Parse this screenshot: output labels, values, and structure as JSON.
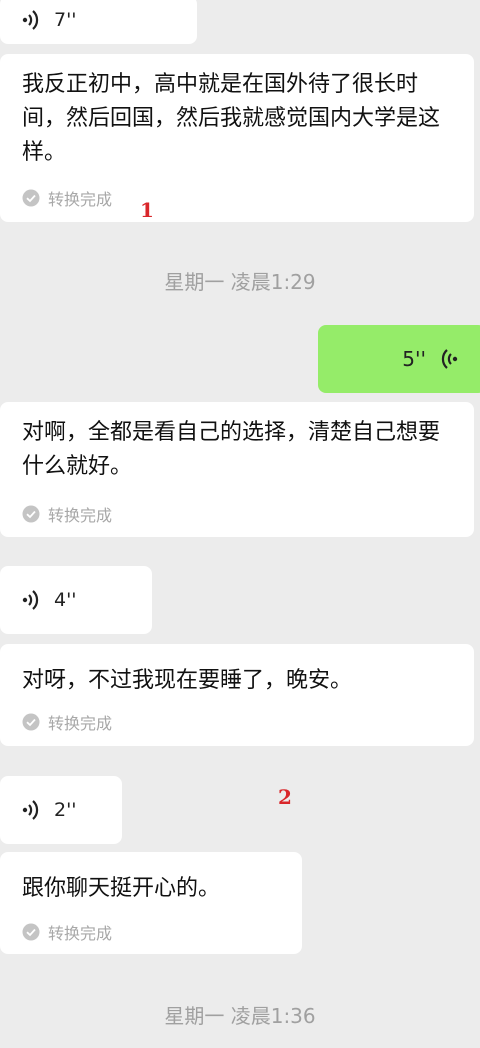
{
  "colors": {
    "background": "#ececec",
    "bubble_in": "#ffffff",
    "bubble_out": "#95ec69",
    "annotation": "#d9262a"
  },
  "messages": [
    {
      "kind": "voice",
      "direction": "in",
      "duration": "7''"
    },
    {
      "kind": "text",
      "direction": "in",
      "text": "我反正初中，高中就是在国外待了很长时间，然后回国，然后我就感觉国内大学是这样。",
      "status": "转换完成"
    },
    {
      "kind": "timestamp",
      "text": "星期一 凌晨1:29"
    },
    {
      "kind": "voice",
      "direction": "out",
      "duration": "5''"
    },
    {
      "kind": "text",
      "direction": "in",
      "text": "对啊，全都是看自己的选择，清楚自己想要什么就好。",
      "status": "转换完成"
    },
    {
      "kind": "voice",
      "direction": "in",
      "duration": "4''"
    },
    {
      "kind": "text",
      "direction": "in",
      "text": "对呀，不过我现在要睡了，晚安。",
      "status": "转换完成"
    },
    {
      "kind": "voice",
      "direction": "in",
      "duration": "2''"
    },
    {
      "kind": "text",
      "direction": "in",
      "text": "跟你聊天挺开心的。",
      "status": "转换完成"
    },
    {
      "kind": "timestamp",
      "text": "星期一 凌晨1:36"
    }
  ],
  "annotations": {
    "marker1": "1",
    "marker2": "2"
  },
  "icons": {
    "voice": "voice-wave-icon",
    "status": "check-circle-icon"
  }
}
